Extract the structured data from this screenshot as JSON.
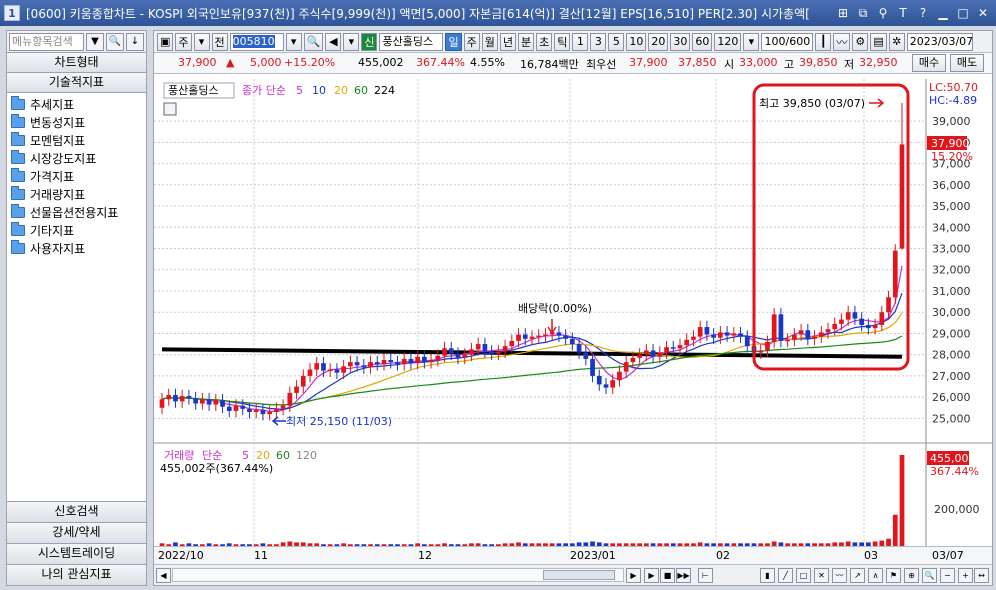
{
  "window": {
    "title": "[0600] 키움종합차트 - KOSPI 외국인보유[937(천)] 주식수[9,999(천)] 액면[5,000] 자본금[614(억)] 결산[12월] EPS[16,510] PER[2.30] 시가총액[",
    "icon_label": "1"
  },
  "sidebar": {
    "search_placeholder": "메뉴항목검색",
    "tab_chart": "차트형태",
    "tab_tech": "기술적지표",
    "tree": [
      "추세지표",
      "변동성지표",
      "모멘텀지표",
      "시장강도지표",
      "가격지표",
      "거래량지표",
      "선물옵션전용지표",
      "기타지표",
      "사용자지표"
    ],
    "bottom_tabs": [
      "신호검색",
      "강세/약세",
      "시스템트레이딩",
      "나의 관심지표"
    ]
  },
  "toolbar": {
    "juga": "주",
    "jeon": "전",
    "code": "005810",
    "sin": "신",
    "stock_name": "풍산홀딩스",
    "periods": [
      "일",
      "주",
      "월",
      "년",
      "분",
      "초",
      "틱"
    ],
    "active_period": "일",
    "numbers": [
      "1",
      "3",
      "5",
      "10",
      "20",
      "30",
      "60",
      "120"
    ],
    "count": "100/600",
    "date": "2023/03/07"
  },
  "quote": {
    "price": "37,900",
    "up_arrow": "▲",
    "change": "5,000",
    "change_pct": "+15.20%",
    "volume": "455,002",
    "vol_ratio": "367.44%",
    "turnover": "4.55%",
    "amount": "16,784백만",
    "best_label": "최우선",
    "best_sell": "37,900",
    "best_buy": "37,850",
    "open_label": "시",
    "open": "33,000",
    "high_label": "고",
    "high": "39,850",
    "low_label": "저",
    "low": "32,950",
    "buy_btn": "매수",
    "sell_btn": "매도"
  },
  "chart_labels": {
    "legend_name": "풍산홀딩스",
    "legend_ma": "종가 단순",
    "ma_periods": [
      "5",
      "10",
      "20",
      "60",
      "224"
    ],
    "ma_colors": [
      "#cc2fd0",
      "#1836c8",
      "#e0a800",
      "#1a8a1a",
      "#6c4e2a"
    ],
    "lc": "LC:50.70",
    "hc": "HC:-4.89",
    "high_note": "최고 39,850 (03/07)",
    "low_note": "최저 25,150 (11/03)",
    "dividend": "배당락(0.00%)",
    "price_tag": "37,900",
    "pct_tag": "15.20%",
    "vol_legend_name": "거래량",
    "vol_legend_ma": "단순",
    "vol_ma_periods": [
      "5",
      "20",
      "60",
      "120"
    ],
    "vol_value": "455,002주(367.44%)",
    "vol_tag": "455,002",
    "vol_pct_tag": "367.44%",
    "x_labels": [
      "2022/10",
      "11",
      "12",
      "2023/01",
      "02",
      "03"
    ],
    "x_right": "03/07"
  },
  "chart_data": {
    "type": "candlestick",
    "y_ticks": [
      39000,
      38000,
      37000,
      36000,
      35000,
      34000,
      33000,
      32000,
      31000,
      30000,
      29000,
      28000,
      27000,
      26000,
      25000
    ],
    "ylim": [
      24500,
      40700
    ],
    "vol_ticks": [
      "200,000"
    ],
    "closes": [
      25900,
      26100,
      25800,
      26050,
      25950,
      25700,
      25900,
      25650,
      25850,
      25550,
      25350,
      25600,
      25450,
      25300,
      25400,
      25200,
      25300,
      25450,
      25600,
      26200,
      26500,
      27000,
      27300,
      27600,
      27250,
      27300,
      27150,
      27450,
      27650,
      27500,
      27400,
      27650,
      27550,
      27750,
      27650,
      27550,
      27800,
      27600,
      27900,
      27650,
      27750,
      27950,
      28300,
      28050,
      27850,
      28000,
      28250,
      28500,
      28150,
      28050,
      28150,
      28400,
      28650,
      28950,
      28750,
      28850,
      28900,
      28950,
      29050,
      28900,
      28750,
      28500,
      28100,
      27800,
      27000,
      26600,
      26450,
      26800,
      27200,
      27650,
      27850,
      28000,
      28200,
      27900,
      28100,
      28350,
      28300,
      28450,
      28700,
      28850,
      29300,
      28950,
      28800,
      29050,
      28900,
      29000,
      28850,
      28400,
      28100,
      28200,
      28600,
      29900,
      28650,
      28700,
      28950,
      29150,
      28750,
      28850,
      29050,
      29200,
      29450,
      29650,
      30000,
      29700,
      29400,
      29250,
      29400,
      30000,
      30700,
      32900,
      37900
    ],
    "opens": [
      25500,
      25900,
      26100,
      25800,
      26050,
      25950,
      25700,
      25900,
      25650,
      25850,
      25550,
      25350,
      25600,
      25450,
      25300,
      25400,
      25200,
      25300,
      25450,
      25600,
      26200,
      26500,
      27000,
      27300,
      27600,
      27250,
      27300,
      27150,
      27450,
      27650,
      27500,
      27400,
      27650,
      27550,
      27750,
      27650,
      27550,
      27800,
      27600,
      27900,
      27650,
      27750,
      27950,
      28300,
      28050,
      27850,
      28000,
      28250,
      28500,
      28150,
      28050,
      28150,
      28400,
      28650,
      28950,
      28750,
      28850,
      28900,
      28950,
      29050,
      28900,
      28750,
      28500,
      28100,
      27800,
      27000,
      26600,
      26450,
      26800,
      27200,
      27650,
      27850,
      28000,
      28200,
      27900,
      28100,
      28350,
      28300,
      28450,
      28700,
      28850,
      29300,
      28950,
      28800,
      29050,
      28900,
      29000,
      28850,
      28400,
      28100,
      28200,
      28600,
      29900,
      28650,
      28700,
      28950,
      29150,
      28750,
      28850,
      29050,
      29200,
      29450,
      29650,
      30000,
      29700,
      29400,
      29250,
      29400,
      30000,
      30700,
      33000
    ],
    "highs_extra": 300,
    "last_high": 39850,
    "last_low": 32950,
    "volume": [
      4,
      3,
      5,
      3,
      4,
      3,
      3,
      4,
      3,
      3,
      4,
      3,
      3,
      3,
      3,
      4,
      3,
      3,
      5,
      6,
      5,
      5,
      4,
      4,
      3,
      3,
      3,
      4,
      3,
      3,
      3,
      3,
      3,
      3,
      3,
      3,
      3,
      3,
      4,
      3,
      3,
      3,
      4,
      3,
      3,
      3,
      4,
      4,
      3,
      3,
      3,
      4,
      4,
      5,
      4,
      4,
      4,
      4,
      4,
      4,
      4,
      4,
      5,
      5,
      6,
      5,
      4,
      4,
      4,
      4,
      4,
      4,
      4,
      4,
      4,
      4,
      4,
      4,
      4,
      4,
      5,
      4,
      4,
      4,
      4,
      4,
      4,
      4,
      4,
      4,
      4,
      6,
      5,
      4,
      4,
      4,
      4,
      4,
      4,
      4,
      5,
      5,
      6,
      5,
      5,
      5,
      6,
      7,
      9,
      35,
      100
    ],
    "trend_line": [
      [
        0,
        28250
      ],
      [
        110,
        27900
      ]
    ],
    "up_color": "#e0161c",
    "down_color": "#1836c8",
    "highlight_color": "#e0161c"
  }
}
